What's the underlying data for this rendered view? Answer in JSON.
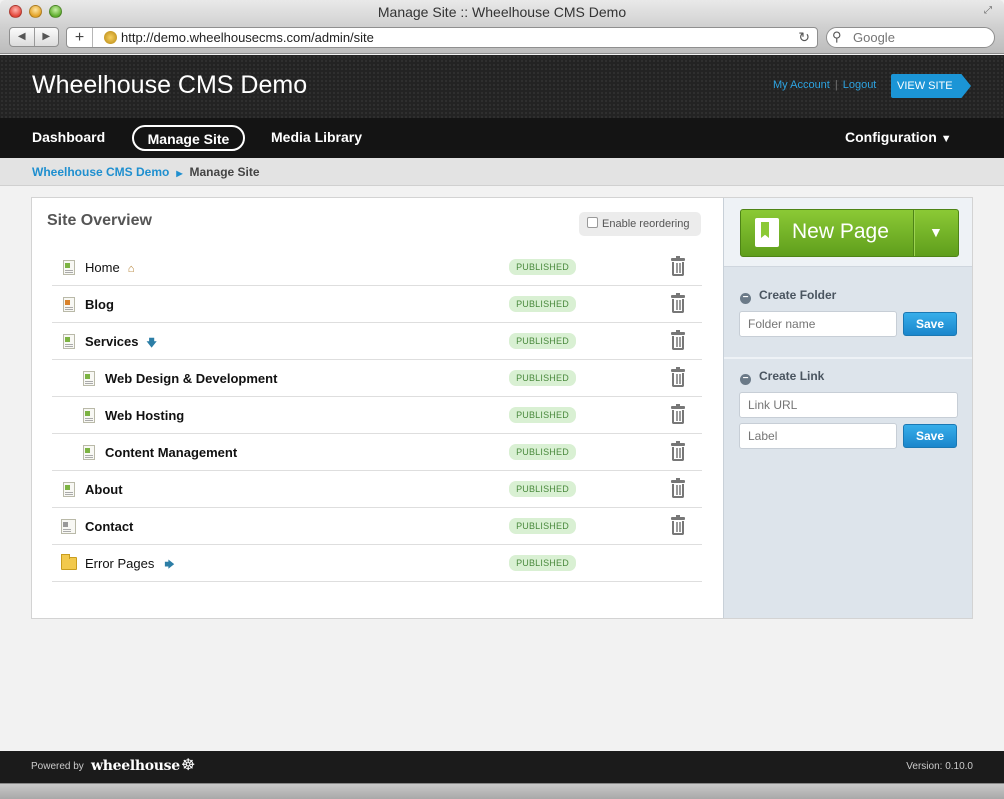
{
  "window": {
    "title": "Manage Site :: Wheelhouse CMS Demo"
  },
  "browser": {
    "url": "http://demo.wheelhousecms.com/admin/site",
    "search_placeholder": "Google"
  },
  "header": {
    "site_title": "Wheelhouse CMS Demo",
    "my_account": "My Account",
    "separator": "|",
    "logout": "Logout",
    "view_site": "VIEW SITE"
  },
  "nav": {
    "dashboard": "Dashboard",
    "manage_site": "Manage Site",
    "media_library": "Media Library",
    "configuration": "Configuration"
  },
  "breadcrumb": {
    "root": "Wheelhouse CMS Demo",
    "current": "Manage Site"
  },
  "overview": {
    "title": "Site Overview",
    "reorder_label": "Enable reordering",
    "pages": [
      {
        "title": "Home",
        "status": "PUBLISHED"
      },
      {
        "title": "Blog",
        "status": "PUBLISHED"
      },
      {
        "title": "Services",
        "status": "PUBLISHED"
      },
      {
        "title": "Web Design & Development",
        "status": "PUBLISHED"
      },
      {
        "title": "Web Hosting",
        "status": "PUBLISHED"
      },
      {
        "title": "Content Management",
        "status": "PUBLISHED"
      },
      {
        "title": "About",
        "status": "PUBLISHED"
      },
      {
        "title": "Contact",
        "status": "PUBLISHED"
      },
      {
        "title": "Error Pages",
        "status": "PUBLISHED"
      }
    ]
  },
  "sidebar": {
    "new_page": "New Page",
    "create_folder": {
      "heading": "Create Folder",
      "folder_placeholder": "Folder name",
      "save": "Save"
    },
    "create_link": {
      "heading": "Create Link",
      "url_placeholder": "Link URL",
      "label_placeholder": "Label",
      "save": "Save"
    }
  },
  "footer": {
    "powered_by": "Powered by",
    "brand": "wheelhouse",
    "version": "Version: 0.10.0"
  },
  "icons": {
    "close": "close-icon",
    "minimize": "minimize-icon",
    "maximize": "maximize-icon",
    "home": "home-icon",
    "trash": "trash-icon",
    "folder": "folder-icon"
  },
  "colors": {
    "accent_blue": "#1b95d6",
    "new_page_green": "#6fb126",
    "published_bg": "#d9f0d3",
    "published_text": "#4a8a3d"
  }
}
